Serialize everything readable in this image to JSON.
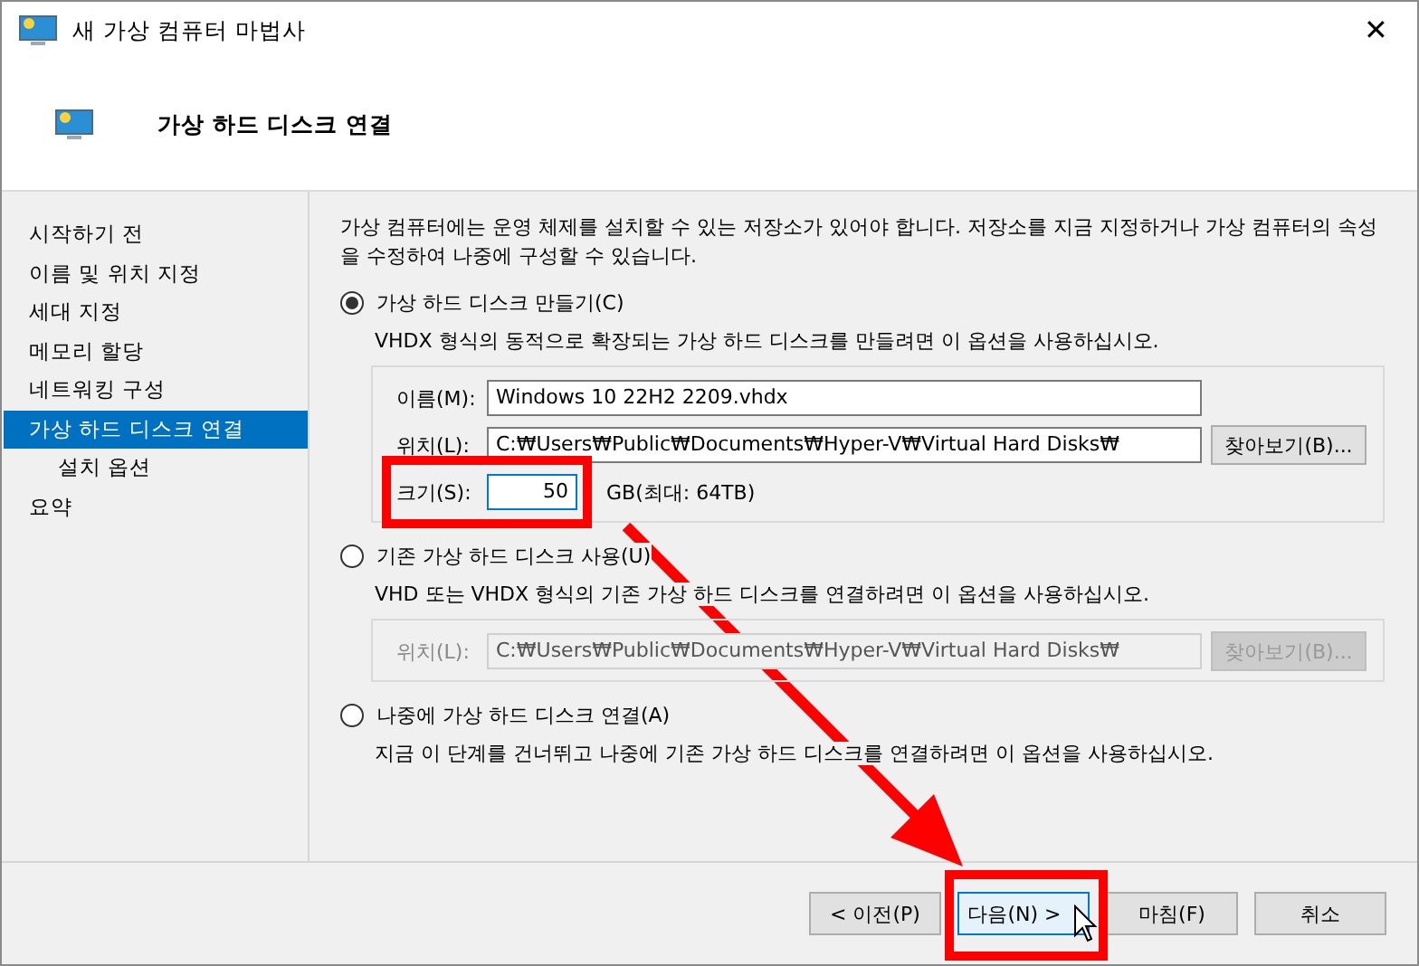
{
  "window": {
    "title": "새 가상 컴퓨터 마법사",
    "close": "✕"
  },
  "header": {
    "title": "가상 하드 디스크 연결"
  },
  "sidebar": {
    "items": [
      {
        "label": "시작하기 전",
        "selected": false
      },
      {
        "label": "이름 및 위치 지정",
        "selected": false
      },
      {
        "label": "세대 지정",
        "selected": false
      },
      {
        "label": "메모리 할당",
        "selected": false
      },
      {
        "label": "네트워킹 구성",
        "selected": false
      },
      {
        "label": "가상 하드 디스크 연결",
        "selected": true,
        "children": [
          {
            "label": "설치 옵션",
            "selected": false
          }
        ]
      },
      {
        "label": "요약",
        "selected": false
      }
    ]
  },
  "intro": "가상 컴퓨터에는 운영 체제를 설치할 수 있는 저장소가 있어야 합니다. 저장소를 지금 지정하거나 가상 컴퓨터의 속성을 수정하여 나중에 구성할 수 있습니다.",
  "options": [
    {
      "label": "가상 하드 디스크 만들기(C)",
      "selected": true,
      "description": "VHDX 형식의 동적으로 확장되는 가상 하드 디스크를 만들려면 이 옵션을 사용하십시오.",
      "disabled": false,
      "fields": [
        {
          "kind": "text",
          "label": "이름(M):",
          "value": "Windows 10 22H2 2209.vhdx"
        },
        {
          "kind": "browse",
          "label": "위치(L):",
          "value": "C:₩Users₩Public₩Documents₩Hyper-V₩Virtual Hard Disks₩",
          "button": "찾아보기(B)..."
        },
        {
          "kind": "size",
          "label": "크기(S):",
          "value": "50",
          "suffix": "GB(최대: 64TB)"
        }
      ]
    },
    {
      "label": "기존 가상 하드 디스크 사용(U)",
      "selected": false,
      "description": "VHD 또는 VHDX 형식의 기존 가상 하드 디스크를 연결하려면 이 옵션을 사용하십시오.",
      "disabled": true,
      "fields": [
        {
          "kind": "browse",
          "label": "위치(L):",
          "value": "C:₩Users₩Public₩Documents₩Hyper-V₩Virtual Hard Disks₩",
          "button": "찾아보기(B)..."
        }
      ]
    },
    {
      "label": "나중에 가상 하드 디스크 연결(A)",
      "selected": false,
      "description": "지금 이 단계를 건너뛰고 나중에 기존 가상 하드 디스크를 연결하려면 이 옵션을 사용하십시오."
    }
  ],
  "buttons": [
    {
      "label": "< 이전(P)",
      "default": false
    },
    {
      "label": "다음(N) >",
      "default": true
    },
    {
      "label": "마침(F)",
      "default": false
    },
    {
      "label": "취소",
      "default": false
    }
  ]
}
